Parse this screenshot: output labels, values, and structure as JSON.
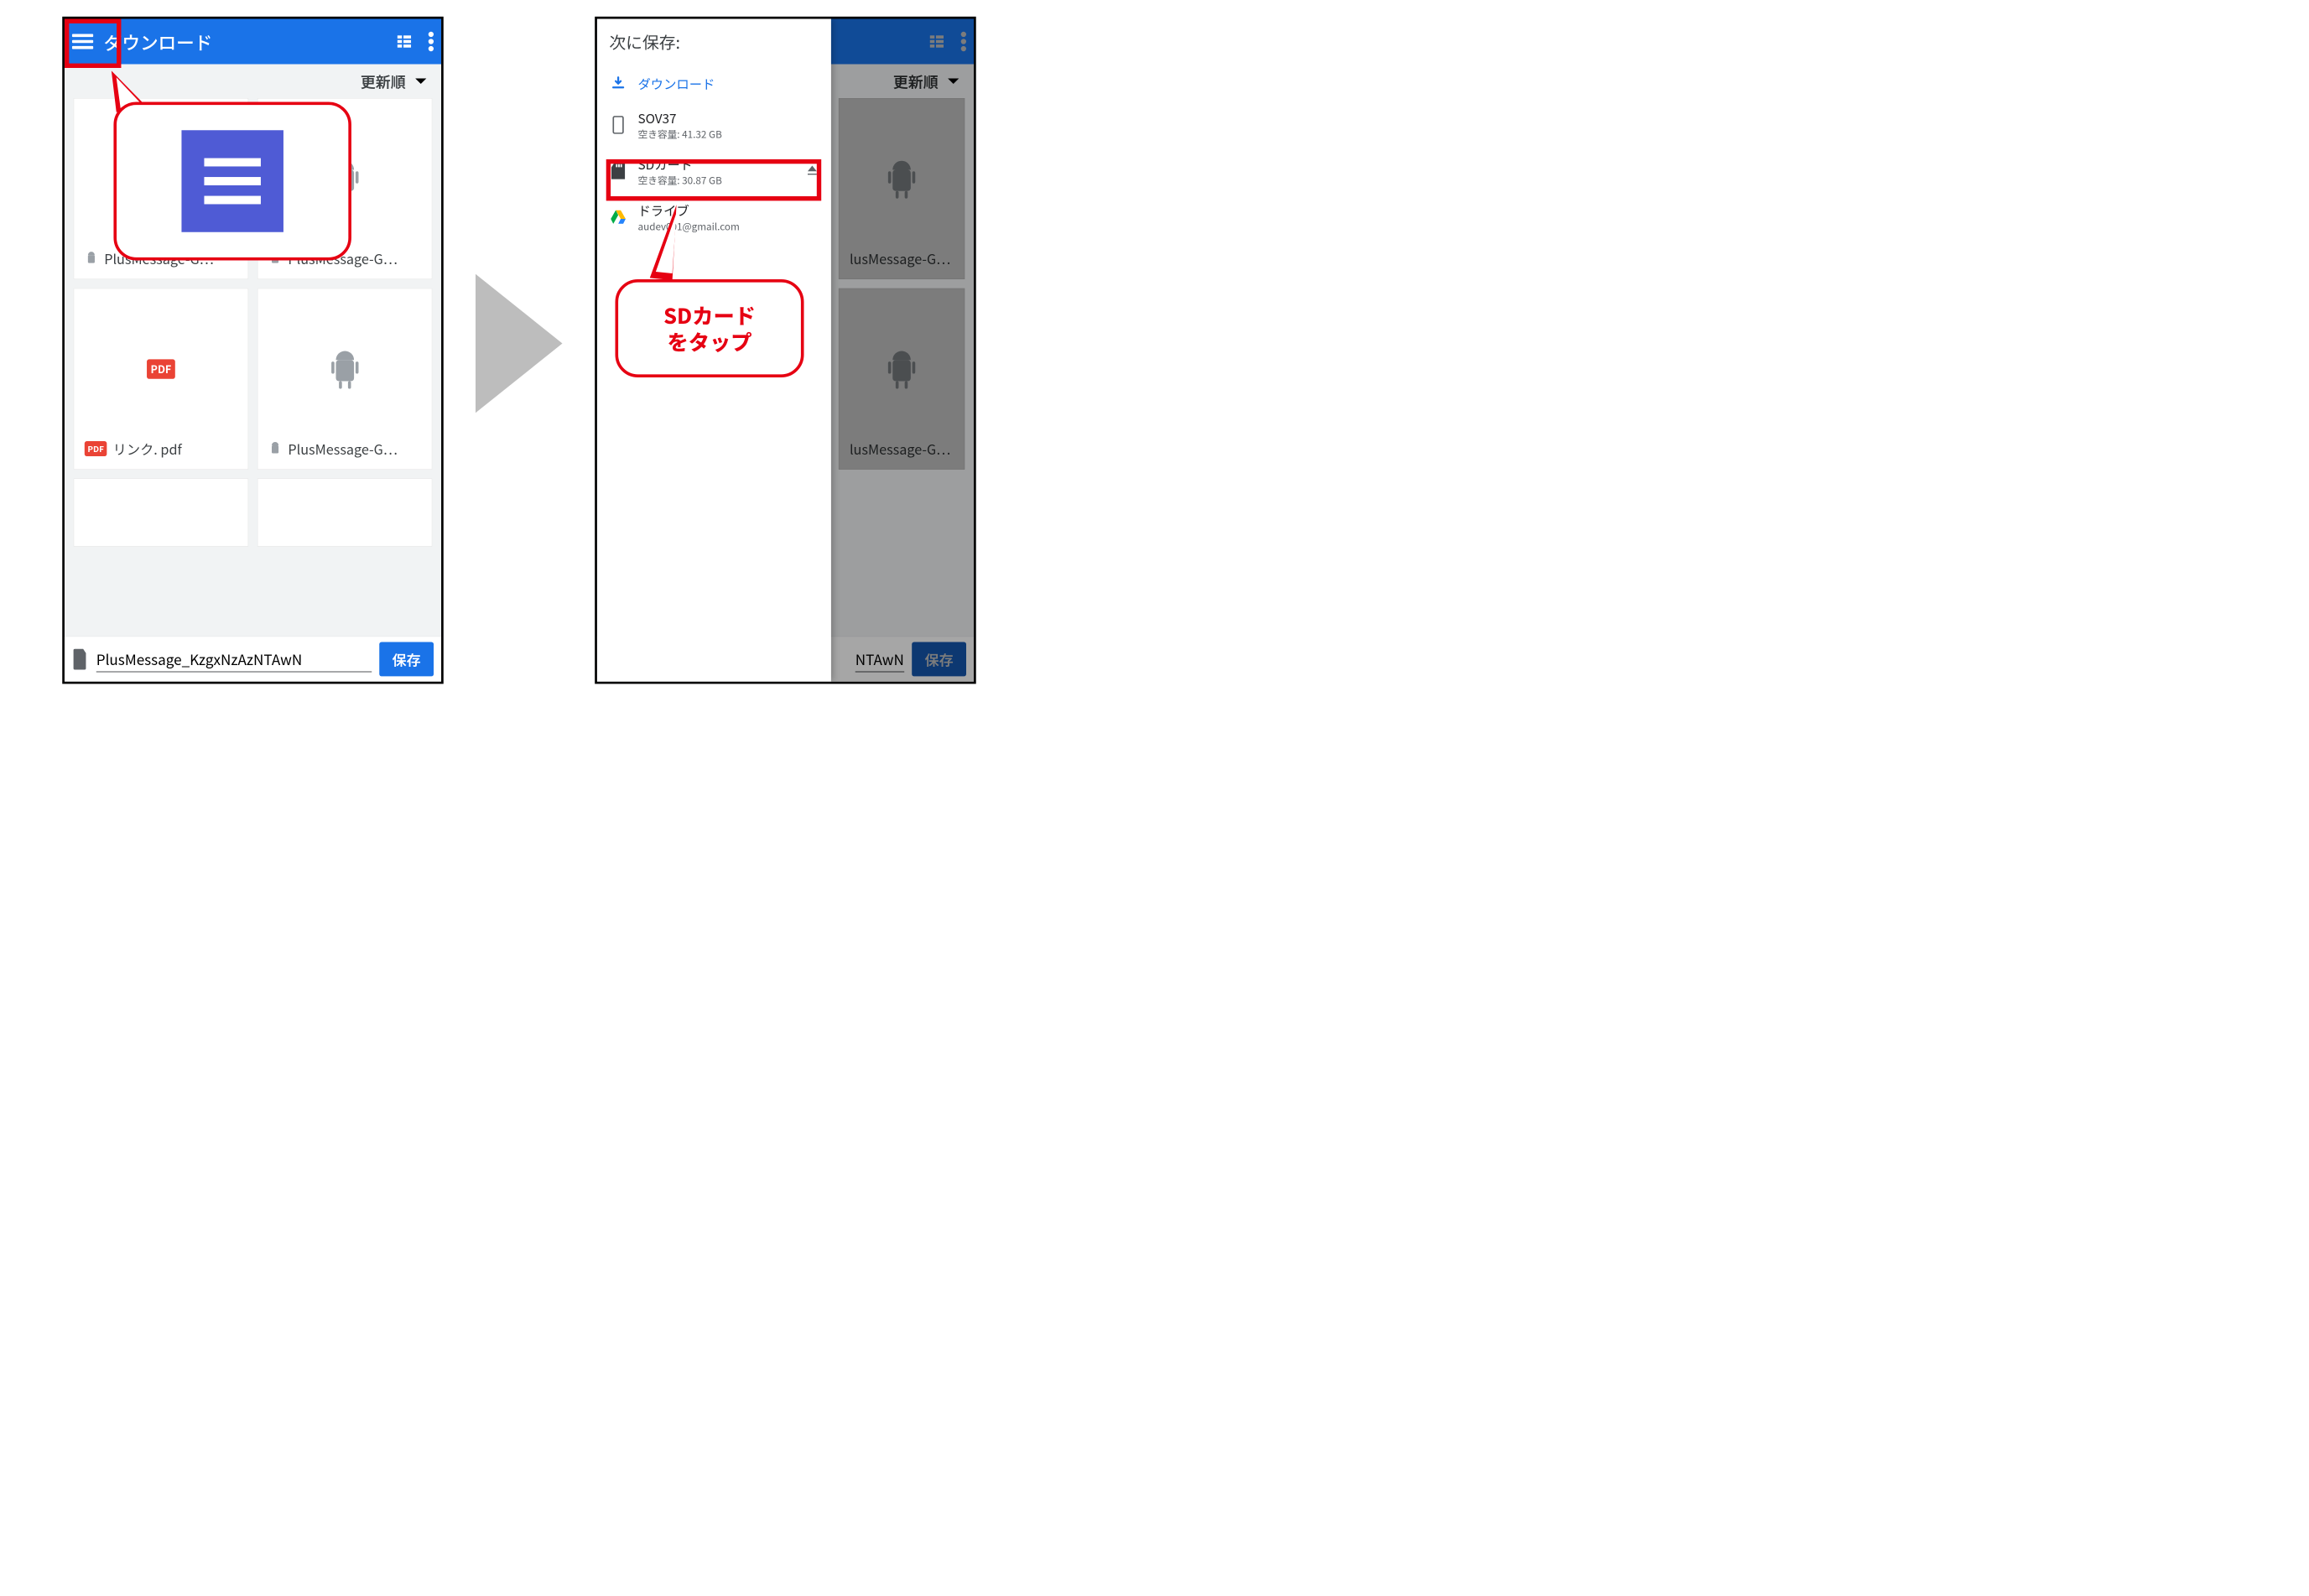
{
  "left": {
    "appbar": {
      "title": "ダウンロード"
    },
    "sort_label": "更新順",
    "tiles": [
      {
        "name": "PlusMessage-G…",
        "kind": "apk"
      },
      {
        "name": "PlusMessage-G…",
        "kind": "apk"
      },
      {
        "name": "リンク. pdf",
        "kind": "pdf"
      },
      {
        "name": "PlusMessage-G…",
        "kind": "apk"
      }
    ],
    "filename": "PlusMessage_KzgxNzAzNTAwN",
    "save_label": "保存"
  },
  "right": {
    "drawer_title": "次に保存:",
    "sort_label": "更新順",
    "drawer_items": {
      "downloads": {
        "label": "ダウンロード"
      },
      "device": {
        "label": "SOV37",
        "sub_prefix": "空き容量:",
        "sub_value": "41.32 GB"
      },
      "sdcard": {
        "label": "SDカード",
        "sub_prefix": "空き容量:",
        "sub_value": "30.87 GB"
      },
      "drive": {
        "label": "ドライブ",
        "sub": "audev001@gmail.com"
      }
    },
    "bg_tiles": [
      {
        "name": "lusMessage-G…"
      },
      {
        "name": "lusMessage-G…"
      }
    ],
    "filename_tail": "NTAwN",
    "save_label": "保存"
  },
  "callouts": {
    "sd_tap": "SDカード\nをタップ"
  }
}
